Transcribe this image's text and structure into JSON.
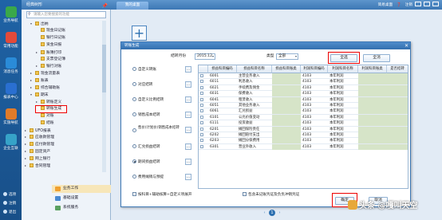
{
  "left_toolbar": {
    "items": [
      {
        "label": "业务导航",
        "icon": "compass-icon",
        "color": "#3aa84a"
      },
      {
        "label": "常用功能",
        "icon": "star-icon",
        "color": "#e24a3a"
      },
      {
        "label": "消息任务",
        "icon": "message-icon",
        "color": "#2a8bd8"
      },
      {
        "label": "报表中心",
        "icon": "report-icon",
        "color": "#2a6fd0"
      },
      {
        "label": "实施导航",
        "icon": "flag-icon",
        "color": "#e07b2a"
      },
      {
        "label": "企业互联",
        "icon": "link-icon",
        "color": "#36a3c8"
      }
    ],
    "bottom": [
      "选项",
      "注销",
      "退出"
    ]
  },
  "nav": {
    "title": "经典树形",
    "search_placeholder": "请输入您要搜索的功能",
    "tree": [
      {
        "label": "出纳",
        "level": 2,
        "toggle": "▾"
      },
      {
        "label": "现金日记账",
        "level": 3
      },
      {
        "label": "银行日记账",
        "level": 3
      },
      {
        "label": "资金日报",
        "level": 3
      },
      {
        "label": "账簿打印",
        "level": 3,
        "toggle": "▸"
      },
      {
        "label": "支票登记簿",
        "level": 3
      },
      {
        "label": "银行对账",
        "level": 3,
        "toggle": "▸"
      },
      {
        "label": "现金流量表",
        "level": 2,
        "toggle": "▸"
      },
      {
        "label": "账表",
        "level": 2,
        "toggle": "▸"
      },
      {
        "label": "综合辅助账",
        "level": 2,
        "toggle": "▸"
      },
      {
        "label": "期末",
        "level": 2,
        "toggle": "▾"
      },
      {
        "label": "转账定义",
        "level": 3,
        "toggle": "▸"
      },
      {
        "label": "转账生成",
        "level": 3,
        "highlight": true
      },
      {
        "label": "对账",
        "level": 3
      },
      {
        "label": "结账",
        "level": 3
      },
      {
        "label": "UFO报表",
        "level": 1,
        "toggle": "▸"
      },
      {
        "label": "应收款管理",
        "level": 1,
        "toggle": "▸"
      },
      {
        "label": "应付款管理",
        "level": 1,
        "toggle": "▸"
      },
      {
        "label": "固定资产",
        "level": 1,
        "toggle": "▸"
      },
      {
        "label": "网上银行",
        "level": 1,
        "toggle": "▸"
      },
      {
        "label": "合同管理",
        "level": 1,
        "toggle": "▸"
      }
    ],
    "bottom_tabs": [
      {
        "label": "业务工作",
        "color": "#f0a030"
      },
      {
        "label": "基础设置",
        "color": "#4a8ad0"
      },
      {
        "label": "系统服务",
        "color": "#5aa060"
      }
    ]
  },
  "tabs": {
    "active": "我的桌面"
  },
  "topbar": {
    "links": [
      "简易桌面",
      "❓",
      "注销"
    ]
  },
  "pager": {
    "current": "1"
  },
  "dialog": {
    "title": "转账生成",
    "period_label": "结转月份",
    "period_value": "2015.12",
    "type_label": "类型",
    "type_value": "全部",
    "select_all_label": "全选",
    "clear_all_label": "全消",
    "options": [
      {
        "label": "自定义转账",
        "checked": false
      },
      {
        "label": "对应结转",
        "checked": false
      },
      {
        "label": "自定义比例结转",
        "checked": false
      },
      {
        "label": "销售成本结转",
        "checked": false
      },
      {
        "label": "售价(计划价)销售成本结转",
        "checked": false,
        "two_line": true
      },
      {
        "label": "汇兑损益结转",
        "checked": false
      },
      {
        "label": "期间损益结转",
        "checked": true
      },
      {
        "label": "费用摊销与预提",
        "checked": false
      }
    ],
    "columns": [
      "",
      "损益科目编码",
      "损益科目名称",
      "损益科目账类",
      "利润科目编码",
      "利润科目名称",
      "利润科目账类",
      "是否结转"
    ],
    "rows": [
      [
        "6001",
        "主营业务收入",
        "",
        "4103",
        "本年利润",
        ""
      ],
      [
        "6011",
        "利息收入",
        "",
        "4103",
        "本年利润",
        ""
      ],
      [
        "6021",
        "手续费及佣金",
        "",
        "4103",
        "本年利润",
        ""
      ],
      [
        "6031",
        "保费收入",
        "",
        "4103",
        "本年利润",
        ""
      ],
      [
        "6041",
        "租赁收入",
        "",
        "4103",
        "本年利润",
        ""
      ],
      [
        "6051",
        "其他业务收入",
        "",
        "4103",
        "本年利润",
        ""
      ],
      [
        "6061",
        "汇兑损益",
        "",
        "4103",
        "本年利润",
        ""
      ],
      [
        "6101",
        "公允价值变动",
        "",
        "4103",
        "本年利润",
        ""
      ],
      [
        "6111",
        "投资收益",
        "",
        "4103",
        "本年利润",
        ""
      ],
      [
        "6201",
        "摊回保险责任",
        "",
        "4103",
        "本年利润",
        ""
      ],
      [
        "6202",
        "摊回赔付支出",
        "",
        "4103",
        "本年利润",
        ""
      ],
      [
        "6203",
        "摊回分保费用",
        "",
        "4103",
        "本年利润",
        ""
      ],
      [
        "6301",
        "营业外收入",
        "",
        "4103",
        "本年利润",
        ""
      ]
    ],
    "check_left": "按科目+辅助核算+自定义项展开",
    "check_right": "包含未记账凭证及负负冲销凭证",
    "ok_label": "确定",
    "cancel_label": "取消"
  },
  "watermark": "头条 @嘎叫天空"
}
